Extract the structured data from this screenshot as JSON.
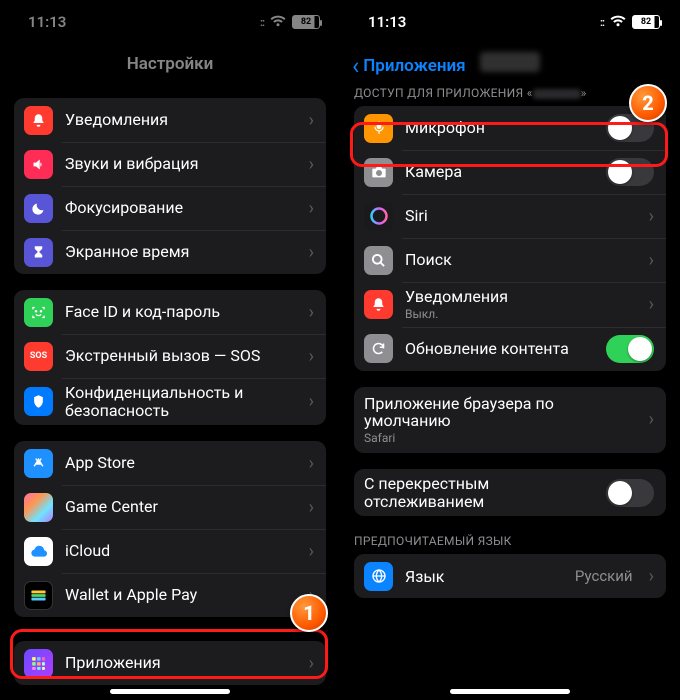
{
  "left": {
    "status": {
      "time": "11:13",
      "battery": "82"
    },
    "header": "Настройки",
    "group1": [
      {
        "name": "Уведомления"
      },
      {
        "name": "Звуки и вибрация"
      },
      {
        "name": "Фокусирование"
      },
      {
        "name": "Экранное время"
      }
    ],
    "group2": [
      {
        "name": "Face ID и код-пароль"
      },
      {
        "name": "Экстренный вызов — SOS"
      },
      {
        "name": "Конфиденциальность и безопасность"
      }
    ],
    "group3": [
      {
        "name": "App Store"
      },
      {
        "name": "Game Center"
      },
      {
        "name": "iCloud"
      },
      {
        "name": "Wallet и Apple Pay"
      }
    ],
    "group4": [
      {
        "name": "Приложения"
      }
    ]
  },
  "right": {
    "status": {
      "time": "11:13",
      "battery": "82"
    },
    "back_label": "Приложения",
    "section_access": "ДОСТУП ДЛЯ ПРИЛОЖЕНИЯ «",
    "section_access_suffix": "»",
    "access": [
      {
        "name": "Микрофон"
      },
      {
        "name": "Камера"
      },
      {
        "name": "Siri"
      },
      {
        "name": "Поиск"
      },
      {
        "name": "Уведомления",
        "sub": "Выкл."
      },
      {
        "name": "Обновление контента"
      }
    ],
    "default_browser": {
      "label": "Приложение браузера по умолчанию",
      "value": "Safari"
    },
    "tracking": {
      "label": "С перекрестным отслеживанием"
    },
    "lang_header": "ПРЕДПОЧИТАЕМЫЙ ЯЗЫК",
    "lang": {
      "label": "Язык",
      "value": "Русский"
    }
  },
  "callouts": {
    "one": "1",
    "two": "2"
  }
}
